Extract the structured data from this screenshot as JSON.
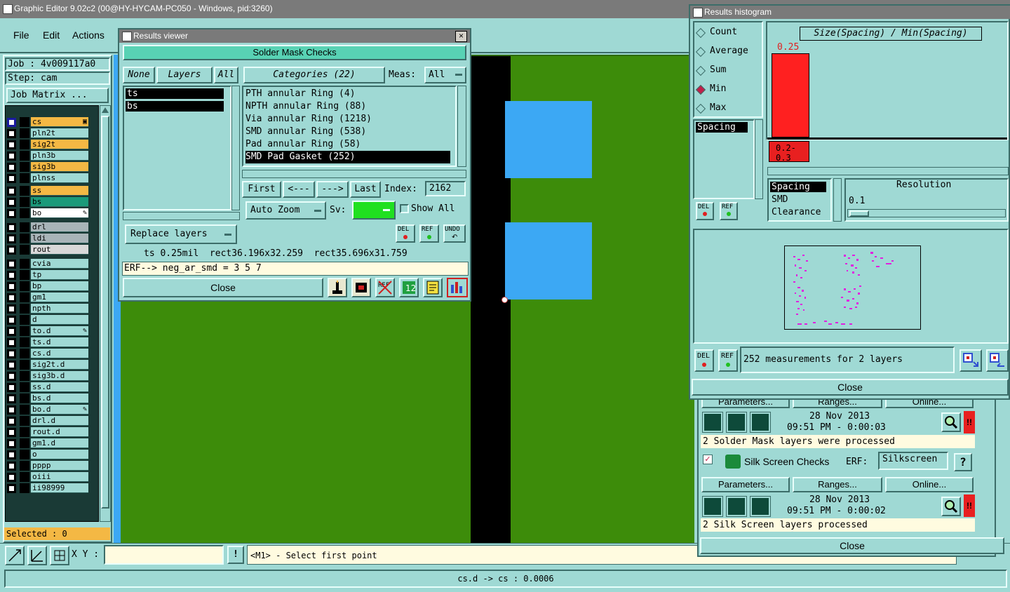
{
  "main_window": {
    "title": "Graphic Editor 9.02c2 (00@HY-HYCAM-PC050 - Windows, pid:3260)",
    "menu": [
      "File",
      "Edit",
      "Actions"
    ],
    "job_label": "Job : 4v009117a0",
    "step_label": "Step: cam",
    "job_matrix_button": "Job Matrix ...",
    "layers": [
      {
        "name": "cs",
        "color": "#f4b844",
        "checked": true,
        "marker": "▣"
      },
      {
        "name": "pln2t",
        "color": "#9fd9d4",
        "checked": false,
        "marker": ""
      },
      {
        "name": "sig2t",
        "color": "#f4b844",
        "checked": false,
        "marker": ""
      },
      {
        "name": "pln3b",
        "color": "#9fd9d4",
        "checked": false,
        "marker": ""
      },
      {
        "name": "sig3b",
        "color": "#f4b844",
        "checked": false,
        "marker": ""
      },
      {
        "name": "plnss",
        "color": "#9fd9d4",
        "checked": false,
        "marker": ""
      },
      {
        "name": "ss",
        "color": "#f4b844",
        "checked": false,
        "marker": ""
      },
      {
        "name": "bs",
        "color": "#1a9a7a",
        "checked": false,
        "marker": ""
      },
      {
        "name": "bo",
        "color": "#ffffff",
        "checked": false,
        "marker": "✎"
      },
      {
        "name": "drl",
        "color": "#a8b4b8",
        "checked": false,
        "marker": ""
      },
      {
        "name": "ldi",
        "color": "#a8b4b8",
        "checked": false,
        "marker": ""
      },
      {
        "name": "rout",
        "color": "#d8d8d8",
        "checked": false,
        "marker": ""
      },
      {
        "name": "cvia",
        "color": "#9fd9d4",
        "checked": false,
        "marker": ""
      },
      {
        "name": "tp",
        "color": "#9fd9d4",
        "checked": false,
        "marker": ""
      },
      {
        "name": "bp",
        "color": "#9fd9d4",
        "checked": false,
        "marker": ""
      },
      {
        "name": "gm1",
        "color": "#9fd9d4",
        "checked": false,
        "marker": ""
      },
      {
        "name": "npth",
        "color": "#9fd9d4",
        "checked": false,
        "marker": ""
      },
      {
        "name": "d",
        "color": "#9fd9d4",
        "checked": false,
        "marker": ""
      },
      {
        "name": "to.d",
        "color": "#9fd9d4",
        "checked": false,
        "marker": "✎"
      },
      {
        "name": "ts.d",
        "color": "#9fd9d4",
        "checked": false,
        "marker": ""
      },
      {
        "name": "cs.d",
        "color": "#9fd9d4",
        "checked": false,
        "marker": ""
      },
      {
        "name": "sig2t.d",
        "color": "#9fd9d4",
        "checked": false,
        "marker": ""
      },
      {
        "name": "sig3b.d",
        "color": "#9fd9d4",
        "checked": false,
        "marker": ""
      },
      {
        "name": "ss.d",
        "color": "#9fd9d4",
        "checked": false,
        "marker": ""
      },
      {
        "name": "bs.d",
        "color": "#9fd9d4",
        "checked": false,
        "marker": ""
      },
      {
        "name": "bo.d",
        "color": "#9fd9d4",
        "checked": false,
        "marker": "✎"
      },
      {
        "name": "drl.d",
        "color": "#9fd9d4",
        "checked": false,
        "marker": ""
      },
      {
        "name": "rout.d",
        "color": "#9fd9d4",
        "checked": false,
        "marker": ""
      },
      {
        "name": "gm1.d",
        "color": "#9fd9d4",
        "checked": false,
        "marker": ""
      },
      {
        "name": "o",
        "color": "#9fd9d4",
        "checked": false,
        "marker": ""
      },
      {
        "name": "pppp",
        "color": "#9fd9d4",
        "checked": false,
        "marker": ""
      },
      {
        "name": "oiii",
        "color": "#9fd9d4",
        "checked": false,
        "marker": ""
      },
      {
        "name": "ii98999",
        "color": "#9fd9d4",
        "checked": false,
        "marker": ""
      }
    ],
    "selected_label": "Selected : 0",
    "xy_label": "X Y :",
    "xy_value": "",
    "exclamation": "!",
    "prompt": "<M1> - Select first point",
    "status_bar": "cs.d -> cs : 0.0006"
  },
  "results_viewer": {
    "title": "Results viewer",
    "header": "Solder Mask Checks",
    "none_button": "None",
    "layers_button": "Layers",
    "all_button": "All",
    "categories_button": "Categories (22)",
    "meas_label": "Meas:",
    "meas_value": "All",
    "layer_list": [
      "ts",
      "bs"
    ],
    "categories": [
      "PTH annular Ring (4)",
      "NPTH annular Ring (88)",
      "Via annular Ring (1218)",
      "SMD annular Ring (538)",
      "Pad annular Ring (58)",
      "SMD Pad Gasket (252)"
    ],
    "selected_category_index": 5,
    "first_button": "First",
    "prev_button": "<---",
    "next_button": "--->",
    "last_button": "Last",
    "index_label": "Index:",
    "index_value": "2162",
    "auto_zoom_button": "Auto Zoom",
    "sv_label": "Sv:",
    "show_all_label": "Show All",
    "del_label": "DEL",
    "ref_label": "REF",
    "undo_label": "UNDO",
    "replace_layers_button": "Replace layers",
    "info_line": "ts 0.25mil  rect36.196x32.259  rect35.696x31.759",
    "erf_line": "ERF--> neg_ar_smd = 3 5 7",
    "close_button": "Close",
    "ref_icon_label": "REF"
  },
  "results_histogram": {
    "title": "Results histogram",
    "modes": [
      "Count",
      "Average",
      "Sum",
      "Min",
      "Max"
    ],
    "selected_mode": "Min",
    "field_list": [
      "Spacing"
    ],
    "formula": "Size(Spacing) / Min(Spacing)",
    "bar_value_label": "0.25",
    "bar_color": "#ff2020",
    "range_label": "0.2-0.3",
    "subfields": [
      "Spacing",
      "SMD",
      "Clearance"
    ],
    "resolution_label": "Resolution",
    "resolution_value": "0.1",
    "del_label": "DEL",
    "ref_label": "REF",
    "measurements_text": "252 measurements for 2 layers",
    "close_button": "Close"
  },
  "checklist_panel": {
    "sm_buttons": [
      "Parameters...",
      "Ranges...",
      "Online..."
    ],
    "sm_date": "28 Nov 2013",
    "sm_time": "09:51 PM - 0:00:03",
    "sm_status": "2 Solder Mask layers were processed",
    "ss_checked": true,
    "ss_title": "Silk Screen Checks",
    "ss_erf_label": "ERF:",
    "ss_erf_value": "Silkscreen",
    "ss_help": "?",
    "ss_buttons": [
      "Parameters...",
      "Ranges...",
      "Online..."
    ],
    "ss_date": "28 Nov 2013",
    "ss_time": "09:51 PM - 0:00:02",
    "ss_status": "2 Silk Screen layers processed",
    "alert": "!!",
    "close_button": "Close"
  }
}
